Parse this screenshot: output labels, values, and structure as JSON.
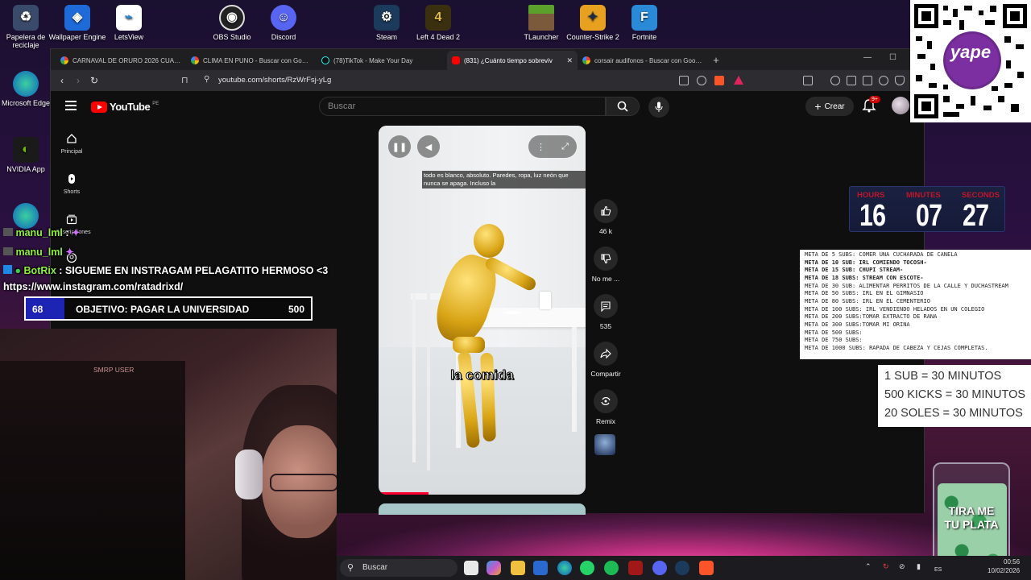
{
  "desktop": {
    "icons": [
      {
        "label": "Papelera de reciclaje",
        "icon": "recycle-bin-icon"
      },
      {
        "label": "Wallpaper Engine",
        "icon": "wallpaper-engine-icon"
      },
      {
        "label": "LetsView",
        "icon": "letsview-icon"
      },
      {
        "label": "OBS Studio",
        "icon": "obs-icon"
      },
      {
        "label": "Discord",
        "icon": "discord-icon"
      },
      {
        "label": "Steam",
        "icon": "steam-icon"
      },
      {
        "label": "Left 4 Dead 2",
        "icon": "left4dead2-icon"
      },
      {
        "label": "TLauncher",
        "icon": "tlauncher-icon"
      },
      {
        "label": "Counter-Strike 2",
        "icon": "counter-strike-icon"
      },
      {
        "label": "Fortnite",
        "icon": "fortnite-icon"
      },
      {
        "label": "Microsoft Edge",
        "icon": "edge-icon"
      },
      {
        "label": "NVIDIA App",
        "icon": "nvidia-icon"
      }
    ]
  },
  "browser": {
    "tabs": [
      {
        "title": "CARNAVAL DE ORURO 2026 CUANDO",
        "favicon": "google-icon"
      },
      {
        "title": "CLIMA EN PUNO - Buscar con Google",
        "favicon": "google-icon"
      },
      {
        "title": "(78)TikTok - Make Your Day",
        "favicon": "tiktok-icon"
      },
      {
        "title": "(831) ¿Cuánto tiempo sobreviv",
        "favicon": "youtube-icon",
        "active": true
      },
      {
        "title": "corsair audifonos - Buscar con Google",
        "favicon": "google-icon"
      }
    ],
    "new_tab": "+",
    "url": "youtube.com/shorts/RzWrFsj-yLg"
  },
  "youtube": {
    "logo_text": "YouTube",
    "country_code": "PE",
    "search_placeholder": "Buscar",
    "create_label": "Crear",
    "notification_count": "9+",
    "sidebar": [
      {
        "label": "Principal",
        "icon": "home-icon"
      },
      {
        "label": "Shorts",
        "icon": "shorts-icon"
      },
      {
        "label": "Suscripciones",
        "icon": "subscriptions-icon"
      },
      {
        "label": "Tú",
        "icon": "you-icon"
      }
    ],
    "short": {
      "caption": "todo es blanco, absoluto. Paredes, ropa, luz neón que nunca se apaga. Incluso la",
      "subtitle": "la comida",
      "progress": 0.24
    },
    "actions": [
      {
        "label": "46 k",
        "icon": "like-icon"
      },
      {
        "label": "No me ...",
        "icon": "dislike-icon"
      },
      {
        "label": "535",
        "icon": "comment-icon"
      },
      {
        "label": "Compartir",
        "icon": "share-icon"
      },
      {
        "label": "Remix",
        "icon": "remix-icon"
      }
    ]
  },
  "chat": {
    "messages": [
      {
        "user": "manu_lml",
        "text": ":"
      },
      {
        "user": "manu_lml",
        "text": ""
      },
      {
        "user": "BotRix",
        "text": ": SIGUEME EN INSTRAGAM PELAGATITO HERMOSO <3"
      },
      {
        "user": "",
        "text": "https://www.instagram.com/ratadrixd/"
      }
    ]
  },
  "goal": {
    "current": "68",
    "label": "OBJETIVO: PAGAR LA UNIVERSIDAD",
    "target": "500",
    "progress": 0.136
  },
  "webcam": {
    "overlay_text": "SMRP USER"
  },
  "timer": {
    "labels": [
      "HOURS",
      "MINUTES",
      "SECONDS"
    ],
    "values": [
      "16",
      "07",
      "27"
    ]
  },
  "metas": [
    {
      "text": "META DE 5 SUBS: COMER UNA CUCHARADA DE CANELA",
      "bold": false
    },
    {
      "text": "META DE 10 SUB: IRL COMIENDO TOCOSH-",
      "bold": true
    },
    {
      "text": "META DE 15 SUB: CHUPI STREAM-",
      "bold": true
    },
    {
      "text": "META DE 18 SUBS: STREAM CON ESCOTE-",
      "bold": true
    },
    {
      "text": "META DE 30 SUB:  ALIMENTAR PERRITOS DE LA CALLE Y DUCHASTREAM",
      "bold": false
    },
    {
      "text": "META DE 50 SUBS: IRL EN EL GIMNASIO",
      "bold": false
    },
    {
      "text": "META DE 80 SUBS: IRL EN EL CEMENTERIO",
      "bold": false
    },
    {
      "text": "META DE 100 SUBS: IRL VENDIENDO HELADOS EN UN COLEGIO",
      "bold": false
    },
    {
      "text": "META DE 200 SUBS:TOMAR EXTRACTO DE RANA",
      "bold": false
    },
    {
      "text": "META DE 300 SUBS:TOMAR MI ORINA",
      "bold": false
    },
    {
      "text": "META DE 500 SUBS:",
      "bold": false
    },
    {
      "text": "META DE 750 SUBS:",
      "bold": false
    },
    {
      "text": "META DE 1000 SUBS: RAPADA DE CABEZA Y CEJAS COMPLETAS.",
      "bold": false
    }
  ],
  "sub_rules": [
    "1 SUB = 30 MINUTOS",
    "500 KICKS = 30 MINUTOS",
    "20 SOLES = 30 MINUTOS"
  ],
  "jar": {
    "line1": "TIRA ME",
    "line2": "TU PLATA"
  },
  "qr": {
    "brand": "yape"
  },
  "taskbar": {
    "search_placeholder": "Buscar",
    "apps": [
      "file-explorer-icon",
      "copilot-icon",
      "folder-icon",
      "store-icon",
      "edge-icon",
      "whatsapp-icon",
      "spotify-icon",
      "dota-icon",
      "discord-icon",
      "steam-icon",
      "brave-icon"
    ],
    "language": "ES",
    "time": "00:56",
    "date": "10/02/2026"
  },
  "colors": {
    "accent_red": "#ff0000",
    "goal_fill": "#1d24b3",
    "timer_label": "#c0162a"
  }
}
